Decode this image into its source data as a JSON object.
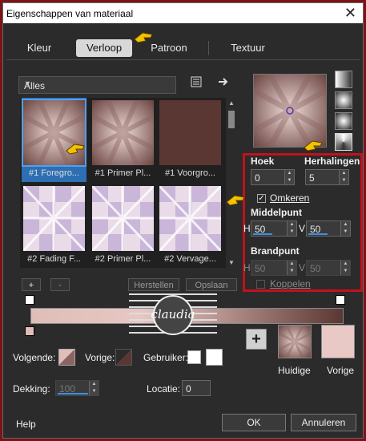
{
  "window": {
    "title": "Eigenschappen van materiaal",
    "close": "✕"
  },
  "tabs": [
    {
      "label": "Kleur"
    },
    {
      "label": "Verloop"
    },
    {
      "label": "Patroon"
    },
    {
      "label": "Textuur"
    }
  ],
  "library": {
    "selected": "Alles",
    "scroll_up": "▲",
    "scroll_down": "▼",
    "dropdown_arrow": "▼"
  },
  "swatches": [
    {
      "label": "#1 Foregro..."
    },
    {
      "label": "#1 Primer Pl..."
    },
    {
      "label": "#1 Voorgro..."
    },
    {
      "label": "#2 Fading F..."
    },
    {
      "label": "#2 Primer Pl..."
    },
    {
      "label": "#2 Vervage..."
    }
  ],
  "editor": {
    "add": "+",
    "remove": "-",
    "reset": "Herstellen",
    "save": "Opslaan"
  },
  "settings": {
    "angle_label": "Hoek",
    "angle_value": "0",
    "repeats_label": "Herhalingen",
    "repeats_value": "5",
    "invert_label": "Omkeren",
    "invert_checked": true,
    "midpoint_label": "Middelpunt",
    "mid_h_label": "H",
    "mid_h_value": "50",
    "mid_v_label": "V",
    "mid_v_value": "50",
    "focal_label": "Brandpunt",
    "focal_h_label": "H",
    "focal_h_value": "50",
    "focal_v_label": "V",
    "focal_v_value": "50",
    "link_label": "Koppelen"
  },
  "bottom": {
    "next_label": "Volgende:",
    "prev_label": "Vorige:",
    "user_label": "Gebruiker:",
    "opacity_label": "Dekking:",
    "opacity_value": "100",
    "location_label": "Locatie:",
    "location_value": "0",
    "add_button": "+",
    "current_label": "Huidige",
    "previous_label": "Vorige"
  },
  "footer": {
    "help": "Help",
    "ok": "OK",
    "cancel": "Annuleren"
  },
  "watermark": {
    "text": "claudia"
  },
  "colors": {
    "accent": "#2d6fb2",
    "highlight_frame": "#c1121b",
    "gradient_light": "#e0bdb8",
    "gradient_dark": "#5b3734",
    "previous_swatch": "#e8c9c5"
  },
  "icons": [
    "pointing-hand-icon",
    "list-icon",
    "arrow-right-icon",
    "check-icon",
    "plus-icon",
    "checker-icon"
  ]
}
